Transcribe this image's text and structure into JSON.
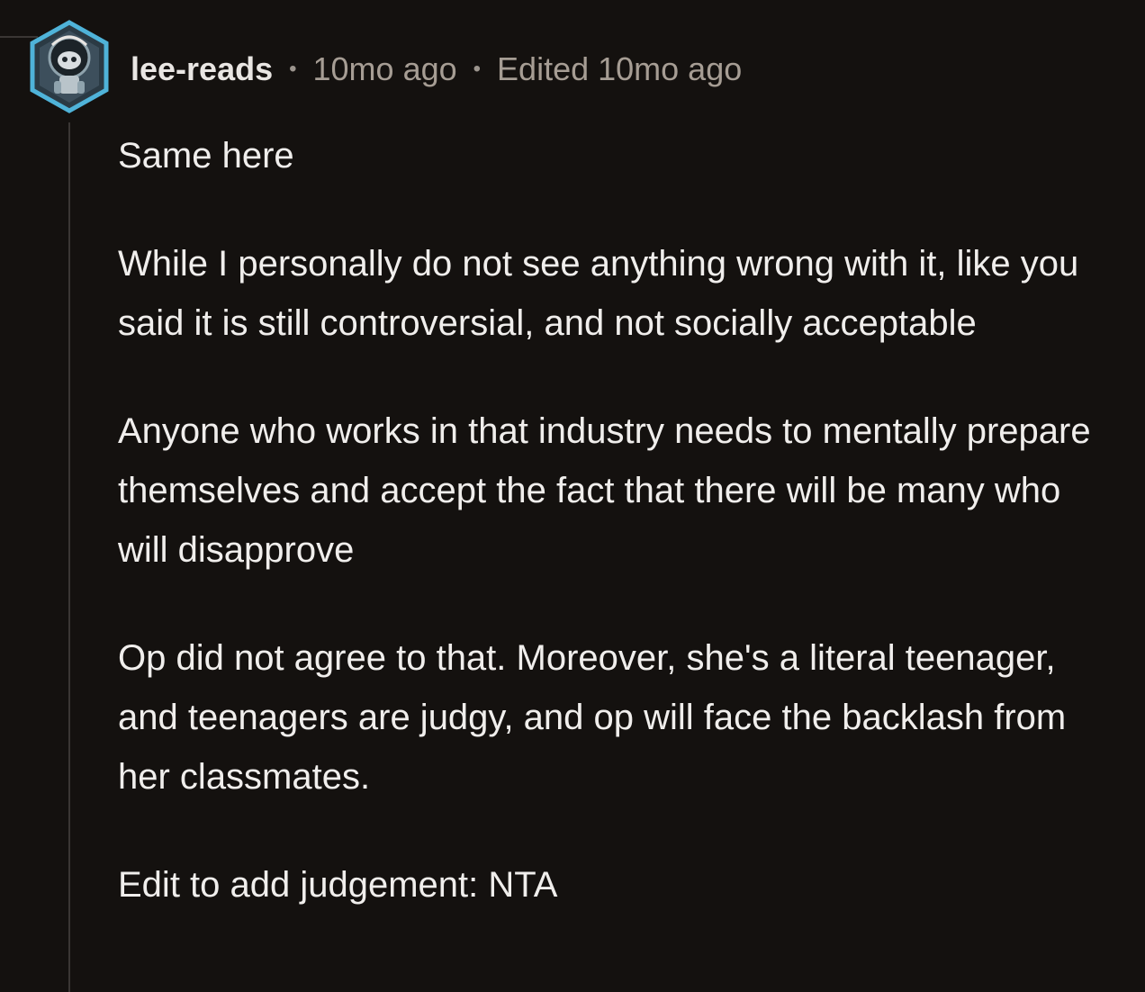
{
  "comment": {
    "avatar_icon": "robot-avatar-icon",
    "username": "lee-reads",
    "separator": "•",
    "timestamp": "10mo ago",
    "edited": "Edited 10mo ago",
    "paragraphs": [
      "Same here",
      "While I personally do not see anything wrong with it, like you said it is still controversial, and not socially acceptable",
      "Anyone who works in that industry needs to mentally prepare themselves and accept the fact that there will be many who will disapprove",
      "Op did not agree to that. Moreover, she's a literal teenager, and teenagers are judgy, and op will face the backlash from her classmates.",
      "Edit to add judgement: NTA"
    ]
  },
  "colors": {
    "background": "#14110f",
    "text": "#f0eeec",
    "meta": "#a69d94",
    "thread_line": "#3a3634",
    "avatar_accent": "#4fb3d9"
  }
}
